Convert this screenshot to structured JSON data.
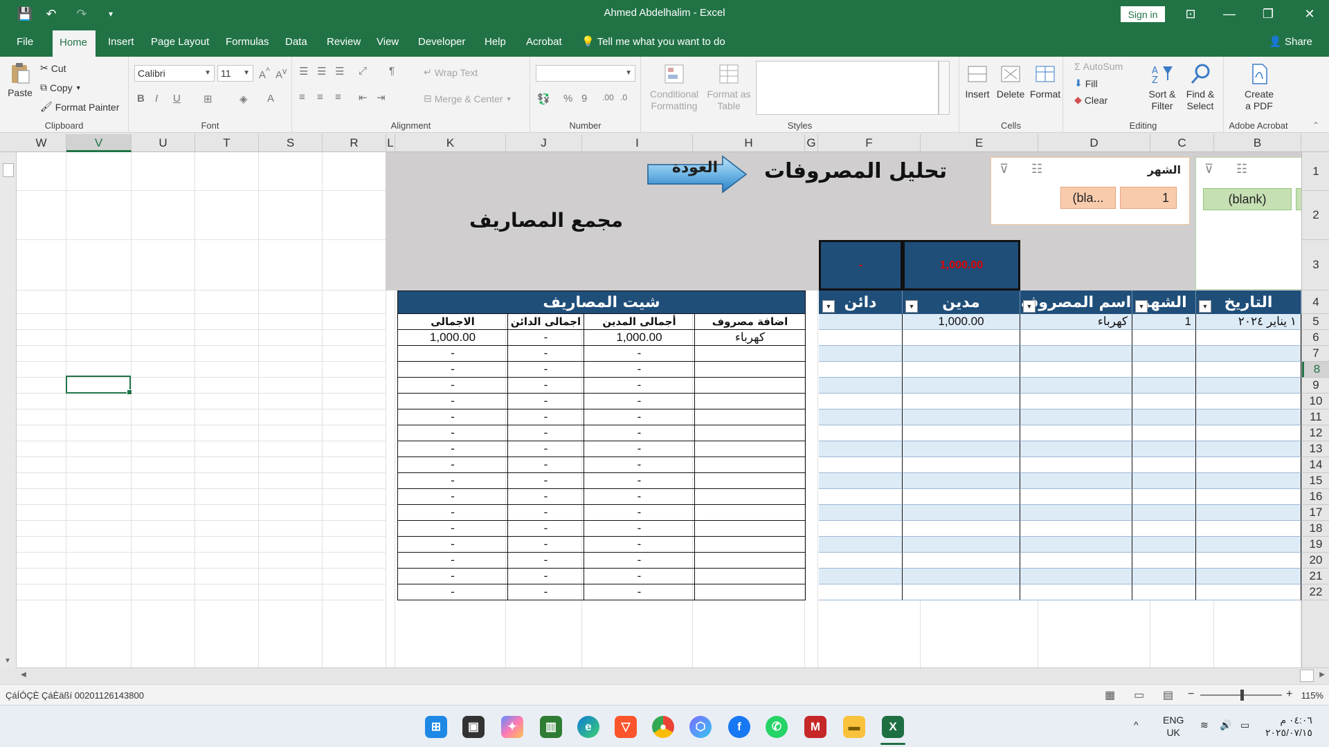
{
  "window": {
    "title": "Ahmed Abdelhalim  -  Excel",
    "sign_in": "Sign in",
    "minimize": "—",
    "restore": "❐",
    "close": "✕",
    "ribbon_display": "⊡"
  },
  "quick_access": {
    "save": "💾",
    "undo": "↶",
    "redo": "↷",
    "customize": "▾"
  },
  "tabs": [
    "File",
    "Home",
    "Insert",
    "Page Layout",
    "Formulas",
    "Data",
    "Review",
    "View",
    "Developer",
    "Help",
    "Acrobat"
  ],
  "tell_me": "Tell me what you want to do",
  "share": "Share",
  "ribbon": {
    "clipboard": {
      "label": "Clipboard",
      "paste": "Paste",
      "cut": "Cut",
      "copy": "Copy",
      "format_painter": "Format Painter"
    },
    "font": {
      "label": "Font",
      "name": "Calibri",
      "size": "11",
      "bold": "B",
      "italic": "I",
      "underline": "U"
    },
    "alignment": {
      "label": "Alignment",
      "wrap_text": "Wrap Text",
      "merge_center": "Merge & Center"
    },
    "number": {
      "label": "Number",
      "percent": "%",
      "comma": "9"
    },
    "styles": {
      "label": "Styles",
      "conditional_1": "Conditional",
      "conditional_2": "Formatting",
      "format_as_1": "Format as",
      "format_as_2": "Table"
    },
    "cells": {
      "label": "Cells",
      "insert": "Insert",
      "delete": "Delete",
      "format": "Format"
    },
    "editing": {
      "label": "Editing",
      "autosum": "AutoSum",
      "fill": "Fill",
      "clear": "Clear",
      "sort_1": "Sort &",
      "sort_2": "Filter",
      "find_1": "Find &",
      "find_2": "Select"
    },
    "acrobat": {
      "label": "Adobe Acrobat",
      "create_1": "Create",
      "create_2": "a PDF"
    }
  },
  "columns": [
    {
      "name": "W",
      "w": 72
    },
    {
      "name": "V",
      "w": 94
    },
    {
      "name": "U",
      "w": 92
    },
    {
      "name": "T",
      "w": 92
    },
    {
      "name": "S",
      "w": 92
    },
    {
      "name": "R",
      "w": 92
    },
    {
      "name": "L",
      "w": 13
    },
    {
      "name": "K",
      "w": 160
    },
    {
      "name": "J",
      "w": 110
    },
    {
      "name": "I",
      "w": 160
    },
    {
      "name": "H",
      "w": 162
    },
    {
      "name": "G",
      "w": 19
    },
    {
      "name": "F",
      "w": 148
    },
    {
      "name": "E",
      "w": 170
    },
    {
      "name": "D",
      "w": 162
    },
    {
      "name": "C",
      "w": 92
    },
    {
      "name": "B",
      "w": 126
    }
  ],
  "rows": [
    "1",
    "2",
    "3",
    "4",
    "5",
    "6",
    "7",
    "8",
    "9",
    "10",
    "11",
    "12",
    "13",
    "14",
    "15",
    "16",
    "17",
    "18",
    "19",
    "20",
    "21",
    "22"
  ],
  "sheet": {
    "analysis_title": "تحليل المصروفات",
    "back_label": "العودة",
    "expense_agg": "مجمع المصاريف",
    "slicer_month": {
      "title": "الشهر",
      "value_1": "1",
      "value_blank": "(bla..."
    },
    "slicer_2": {
      "value_blank": "(blank)"
    },
    "sum_debit": "1,000.00",
    "sum_credit": "-",
    "left_table": {
      "header_right": [
        "التاريخ",
        "الشهر",
        "اسم المصروف",
        "مدين",
        "دائن"
      ],
      "row1": {
        "date": "١ يناير ٢٠٢٤",
        "month": "1",
        "name": "كهرباء",
        "debit": "1,000.00"
      }
    },
    "right_table": {
      "title": "شيت المصاريف",
      "columns": [
        "اضافة مصروف",
        "أجمالى المدين",
        "اجمالى الدائن",
        "الاجمالى"
      ],
      "first_row": [
        "كهرباء",
        "1,000.00",
        "-",
        "1,000.00"
      ],
      "empty_value": "-"
    }
  },
  "status": {
    "left": "ÇáÍÓÇÈ ÇáÈäßí 00201126143800",
    "zoom": "115%",
    "zoom_minus": "−",
    "zoom_plus": "+"
  },
  "taskbar": {
    "lang_1": "ENG",
    "lang_2": "UK",
    "time": "٠٤:٠٦ م",
    "date": "٢٠٢٥/٠٧/١٥",
    "chevron": "^",
    "apps": [
      "start-icon",
      "task-view-icon",
      "copilot-icon",
      "store-icon",
      "edge-icon",
      "brave-icon",
      "chrome-icon",
      "shield-icon",
      "facebook-icon",
      "whatsapp-icon",
      "gmail-icon",
      "explorer-icon",
      "excel-icon"
    ]
  }
}
